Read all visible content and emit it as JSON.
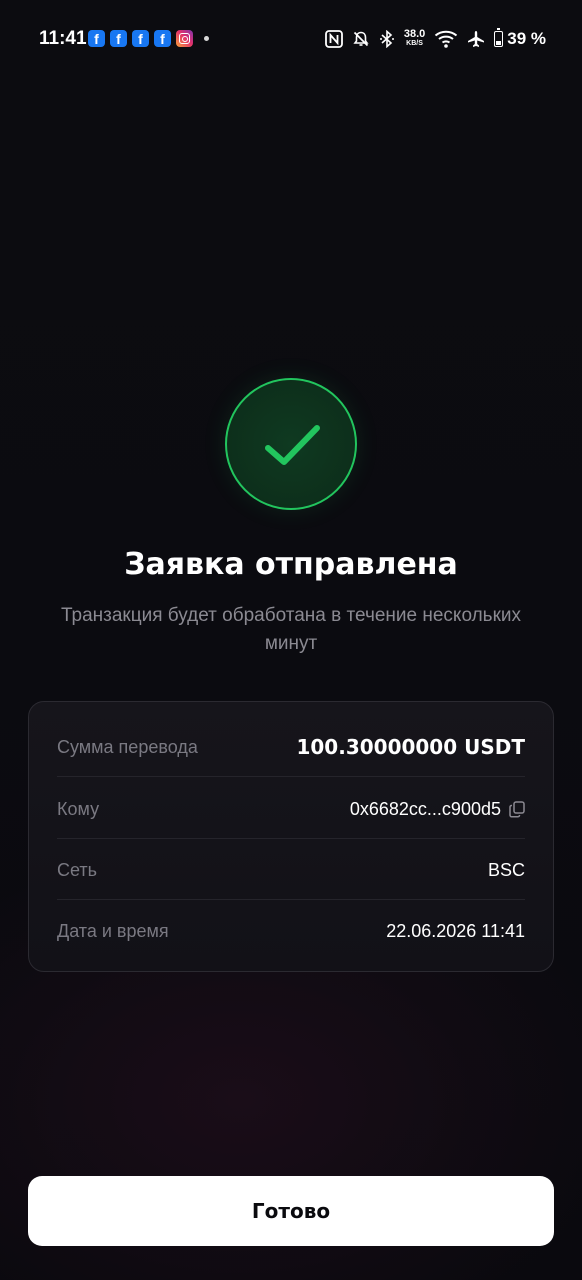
{
  "status_bar": {
    "time": "11:41",
    "net_speed_value": "38.0",
    "net_speed_unit": "KB/S",
    "battery_text": "39 %",
    "battery_level": 0.39,
    "notification_icons": [
      "facebook-icon",
      "facebook-icon",
      "facebook-icon",
      "facebook-icon",
      "instagram-icon"
    ],
    "system_icons": [
      "nfc-icon",
      "mute-icon",
      "bluetooth-icon",
      "wifi-icon",
      "airplane-icon",
      "battery-icon"
    ]
  },
  "success": {
    "icon": "checkmark-icon",
    "accent_color": "#22c55e",
    "title": "Заявка отправлена",
    "subtitle": "Транзакция будет обработана в течение нескольких минут"
  },
  "details": {
    "amount_label": "Сумма перевода",
    "amount_value": "100.30000000 USDT",
    "to_label": "Кому",
    "to_value": "0x6682cc...c900d5",
    "network_label": "Сеть",
    "network_value": "BSC",
    "datetime_label": "Дата и время",
    "datetime_value": "22.06.2026 11:41"
  },
  "actions": {
    "done_label": "Готово"
  }
}
